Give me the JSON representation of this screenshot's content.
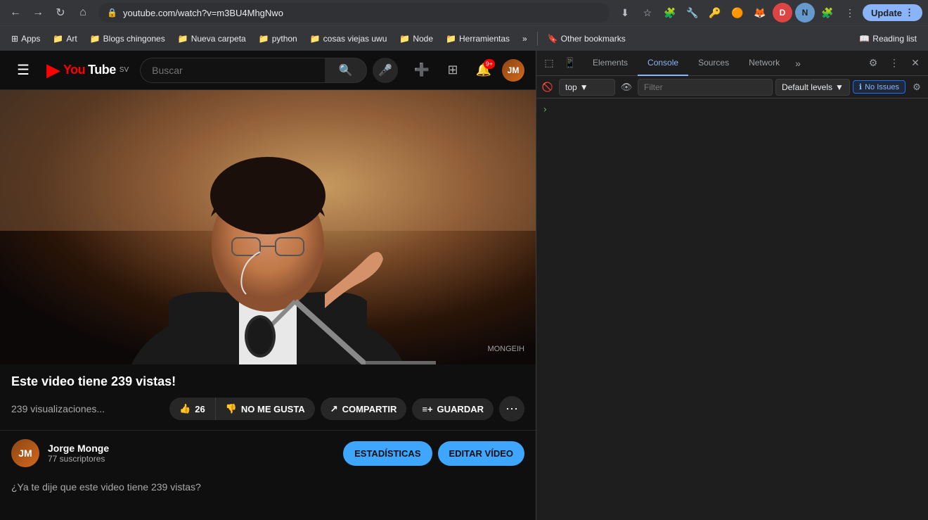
{
  "browser": {
    "nav": {
      "back_label": "←",
      "forward_label": "→",
      "refresh_label": "↻",
      "home_label": "⌂"
    },
    "address_bar": {
      "url": "youtube.com/watch?v=m3BU4MhgNwo",
      "lock_icon": "🔒"
    },
    "toolbar": {
      "download_icon": "⬇",
      "bookmark_icon": "☆",
      "extension_icon": "🧩",
      "profile_icon": "👤",
      "more_icon": "⋮",
      "update_label": "Update",
      "update_icon": "⋮"
    },
    "bookmarks": [
      {
        "icon": "🔖",
        "label": "Apps"
      },
      {
        "icon": "📁",
        "label": "Art"
      },
      {
        "icon": "📁",
        "label": "Blogs chingones"
      },
      {
        "icon": "📁",
        "label": "Nueva carpeta"
      },
      {
        "icon": "📁",
        "label": "python"
      },
      {
        "icon": "📁",
        "label": "cosas viejas uwu"
      },
      {
        "icon": "📁",
        "label": "Node"
      },
      {
        "icon": "📁",
        "label": "Herramientas"
      }
    ],
    "bookmarks_more": "»",
    "other_bookmarks_label": "Other bookmarks",
    "reading_list_label": "Reading list"
  },
  "youtube": {
    "header": {
      "menu_icon": "☰",
      "logo_text": "YouTube",
      "logo_badge": "SV",
      "search_placeholder": "Buscar",
      "search_icon": "🔍",
      "mic_icon": "🎤",
      "create_icon": "➕",
      "apps_icon": "⊞",
      "notification_icon": "🔔",
      "notification_count": "9+",
      "avatar_initials": "JM"
    },
    "video": {
      "watermark": "MONGEIH",
      "title": "Este video tiene 239 vistas!",
      "views": "239 visualizaciones...",
      "like_count": "26",
      "like_icon": "👍",
      "dislike_label": "NO ME GUSTA",
      "dislike_icon": "👎",
      "share_label": "COMPARTIR",
      "share_icon": "↗",
      "save_label": "GUARDAR",
      "save_icon": "≡+",
      "more_icon": "⋯"
    },
    "channel": {
      "name": "Jorge Monge",
      "subscribers": "77 suscriptores",
      "stats_btn": "ESTADÍSTICAS",
      "edit_btn": "EDITAR VÍDEO"
    },
    "description": "¿Ya te dije que este video tiene 239 vistas?"
  },
  "devtools": {
    "icons_left": {
      "cursor_icon": "⬚",
      "mobile_icon": "📱"
    },
    "tabs": [
      {
        "label": "Elements",
        "active": false
      },
      {
        "label": "Console",
        "active": true
      },
      {
        "label": "Sources",
        "active": false
      },
      {
        "label": "Network",
        "active": false
      }
    ],
    "tabs_more": "»",
    "toolbar_right": {
      "settings_icon": "⚙",
      "more_icon": "⋮",
      "close_icon": "✕"
    },
    "console_bar": {
      "clear_icon": "🚫",
      "context_label": "top",
      "context_arrow": "▼",
      "eye_icon": "👁",
      "filter_placeholder": "Filter",
      "levels_label": "Default levels",
      "levels_arrow": "▼",
      "issues_icon": "ℹ",
      "issues_label": "No Issues",
      "settings_icon": "⚙"
    },
    "console_content": {
      "prompt_icon": "›"
    }
  }
}
